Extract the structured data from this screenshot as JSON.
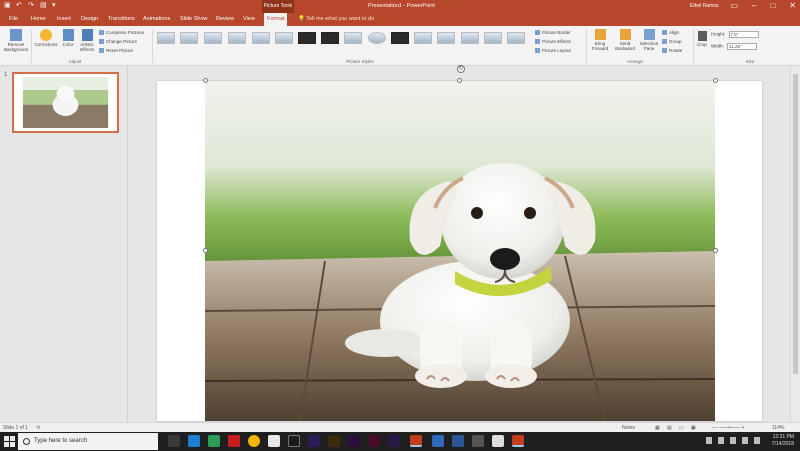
{
  "titlebar": {
    "context_tab": "Picture Tools",
    "doc_title": "Presentation1 - PowerPoint",
    "user": "Ethel Ramos",
    "qat_icons": [
      "save-icon",
      "undo-icon",
      "redo-icon",
      "present-icon",
      "customize-icon"
    ]
  },
  "tabs": [
    "File",
    "Home",
    "Insert",
    "Design",
    "Transitions",
    "Animations",
    "Slide Show",
    "Review",
    "View",
    "Format"
  ],
  "active_tab": "Format",
  "tell_me": "Tell me what you want to do",
  "ribbon": {
    "remove_background": "Remove Background",
    "corrections": "Corrections",
    "color": "Color",
    "artistic_effects": "Artistic Effects",
    "compress_pictures": "Compress Pictures",
    "change_picture": "Change Picture",
    "reset_picture": "Reset Picture",
    "adjust_label": "Adjust",
    "picture_styles_label": "Picture Styles",
    "picture_border": "Picture Border",
    "picture_effects": "Picture Effects",
    "picture_layout": "Picture Layout",
    "bring_forward": "Bring Forward",
    "send_backward": "Send Backward",
    "selection_pane": "Selection Pane",
    "align": "Align",
    "group": "Group",
    "rotate": "Rotate",
    "arrange_label": "Arrange",
    "crop": "Crop",
    "height_label": "Height:",
    "height_value": "7.5\"",
    "width_label": "Width:",
    "width_value": "11.25\"",
    "size_label": "Size"
  },
  "slides_panel": {
    "slide_number": "1"
  },
  "status": {
    "slide_info": "Slide 1 of 1",
    "notes": "Notes",
    "zoom": "114%"
  },
  "taskbar": {
    "search_placeholder": "Type here to search",
    "time": "12:31 PM",
    "date": "7/14/2018"
  },
  "colors": {
    "accent": "#b7472a",
    "selected_thumb_border": "#d26e4b"
  }
}
